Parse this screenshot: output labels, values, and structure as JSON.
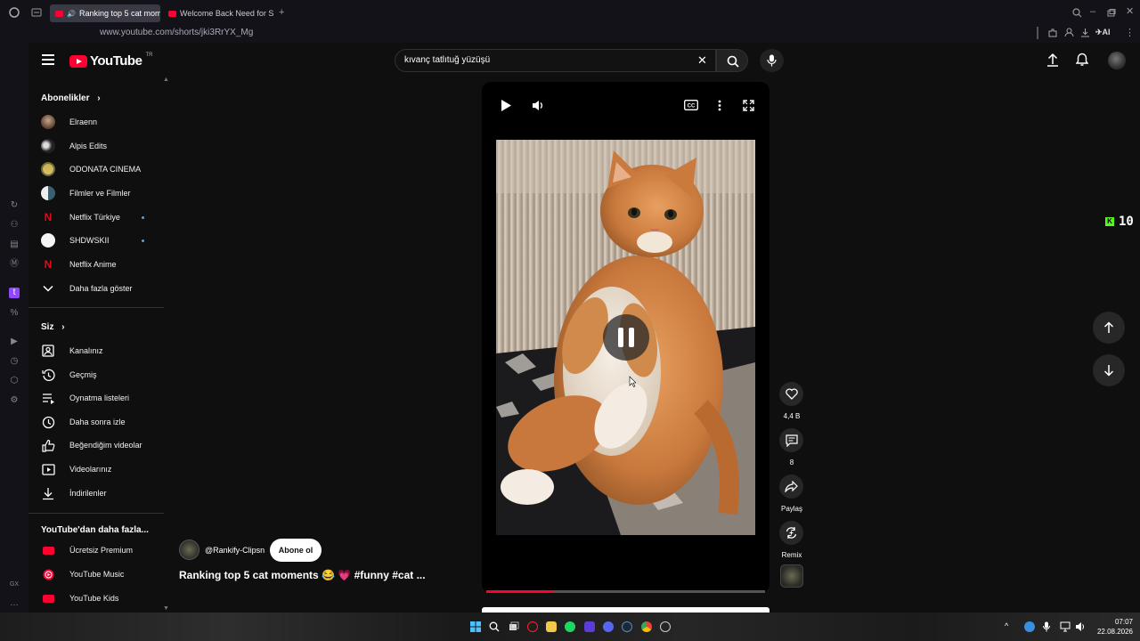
{
  "browser": {
    "tabs": [
      {
        "label": "Ranking top 5 cat mom",
        "active": true
      },
      {
        "label": "Welcome Back Need for Sp",
        "active": false
      }
    ],
    "url": "www.youtube.com/shorts/jki3RrYX_Mg",
    "ai_label": "AI"
  },
  "header": {
    "logo_text": "YouTube",
    "logo_region": "TR",
    "search_value": "kıvanç tatlıtuğ yüzüşü"
  },
  "guide": {
    "subscriptions_title": "Abonelikler",
    "subscriptions": [
      {
        "label": "Elraenn",
        "dot": false
      },
      {
        "label": "Alpis Edits",
        "dot": false
      },
      {
        "label": "ODONATA CINEMA",
        "dot": false
      },
      {
        "label": "Filmler ve Filmler",
        "dot": false
      },
      {
        "label": "Netflix Türkiye",
        "dot": true
      },
      {
        "label": "SHDWSKII",
        "dot": true
      },
      {
        "label": "Netflix Anime",
        "dot": false
      }
    ],
    "show_more": "Daha fazla göster",
    "you_title": "Siz",
    "you_items": [
      {
        "label": "Kanalınız",
        "icon": "channel-icon"
      },
      {
        "label": "Geçmiş",
        "icon": "history-icon"
      },
      {
        "label": "Oynatma listeleri",
        "icon": "playlists-icon"
      },
      {
        "label": "Daha sonra izle",
        "icon": "watch-later-icon"
      },
      {
        "label": "Beğendiğim videolar",
        "icon": "like-icon"
      },
      {
        "label": "Videolarınız",
        "icon": "your-videos-icon"
      },
      {
        "label": "İndirilenler",
        "icon": "download-icon"
      }
    ],
    "more_title": "YouTube'dan daha fazla...",
    "more_items": [
      {
        "label": "Ücretsiz Premium"
      },
      {
        "label": "YouTube Music"
      },
      {
        "label": "YouTube Kids"
      }
    ]
  },
  "short": {
    "channel_handle": "@Rankify-Clipsn",
    "subscribe_label": "Abone ol",
    "title": "Ranking top 5 cat moments 😂 💗 #funny #cat ...",
    "progress": 0.24
  },
  "actions": {
    "like_count": "4,4 B",
    "comment_count": "8",
    "share_label": "Paylaş",
    "remix_label": "Remix"
  },
  "kick": {
    "count": "10"
  },
  "taskbar": {
    "time": "07:07",
    "date": "22.08.2026"
  },
  "colors": {
    "accent": "#ff0033",
    "background": "#0f0f0f",
    "kick_green": "#53fc18"
  }
}
